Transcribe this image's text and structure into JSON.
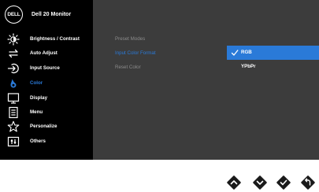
{
  "header": {
    "logo_text": "DELL",
    "title": "Dell 20 Monitor"
  },
  "menu": [
    {
      "label": "Brightness / Contrast",
      "icon": "brightness-icon",
      "active": false
    },
    {
      "label": "Auto Adjust",
      "icon": "auto-adjust-icon",
      "active": false
    },
    {
      "label": "Input Source",
      "icon": "input-source-icon",
      "active": false
    },
    {
      "label": "Color",
      "icon": "color-icon",
      "active": true
    },
    {
      "label": "Display",
      "icon": "display-icon",
      "active": false
    },
    {
      "label": "Menu",
      "icon": "menu-icon",
      "active": false
    },
    {
      "label": "Personalize",
      "icon": "personalize-icon",
      "active": false
    },
    {
      "label": "Others",
      "icon": "others-icon",
      "active": false
    }
  ],
  "submenu": [
    {
      "label": "Preset Modes",
      "active": false
    },
    {
      "label": "Input Color Format",
      "active": true
    },
    {
      "label": "Reset Color",
      "active": false
    }
  ],
  "options": [
    {
      "label": "RGB",
      "selected": true
    },
    {
      "label": "YPbPr",
      "selected": false
    }
  ],
  "buttons": [
    {
      "icon": "up-arrow-icon"
    },
    {
      "icon": "down-arrow-icon"
    },
    {
      "icon": "check-icon"
    },
    {
      "icon": "back-icon"
    }
  ],
  "colors": {
    "accent": "#2a7ad8",
    "panel": "#3c3c3c",
    "sidebar": "#000000"
  }
}
